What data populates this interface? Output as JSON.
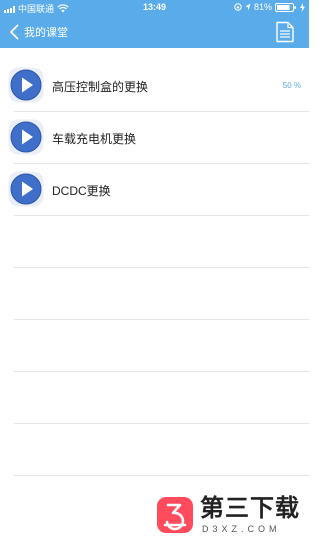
{
  "status_bar": {
    "carrier": "中国联通",
    "time": "13:49",
    "battery": "81%"
  },
  "nav": {
    "back_label": "我的课堂",
    "right_icon": "document-icon"
  },
  "lessons": [
    {
      "title": "高压控制盒的更换",
      "progress": "50 %"
    },
    {
      "title": "车载充电机更换",
      "progress": ""
    },
    {
      "title": "DCDC更换",
      "progress": ""
    }
  ],
  "watermark": {
    "text": "第三下载",
    "sub": "D3XZ.COM"
  },
  "colors": {
    "accent": "#5aabea",
    "play": "#3f6fc8"
  }
}
